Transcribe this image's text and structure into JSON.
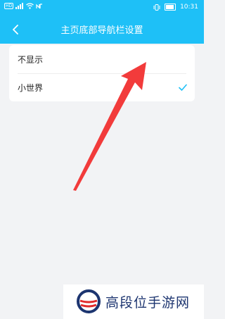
{
  "status_bar": {
    "left_badge": "HD",
    "time": "10:31",
    "icons": [
      "signal-icon",
      "wifi-icon",
      "nfc-icon",
      "vibrate-icon",
      "battery-icon"
    ]
  },
  "header": {
    "back_icon": "chevron-left-icon",
    "title": "主页底部导航栏设置"
  },
  "options": [
    {
      "label": "不显示",
      "selected": false
    },
    {
      "label": "小世界",
      "selected": true
    }
  ],
  "watermark": {
    "text": "高段位手游网"
  },
  "colors": {
    "header_bg": "#1ec0f7",
    "check": "#1ec0f7",
    "arrow": "#f23b3b",
    "watermark_text": "#1d3570",
    "watermark_red": "#e02b2b"
  }
}
